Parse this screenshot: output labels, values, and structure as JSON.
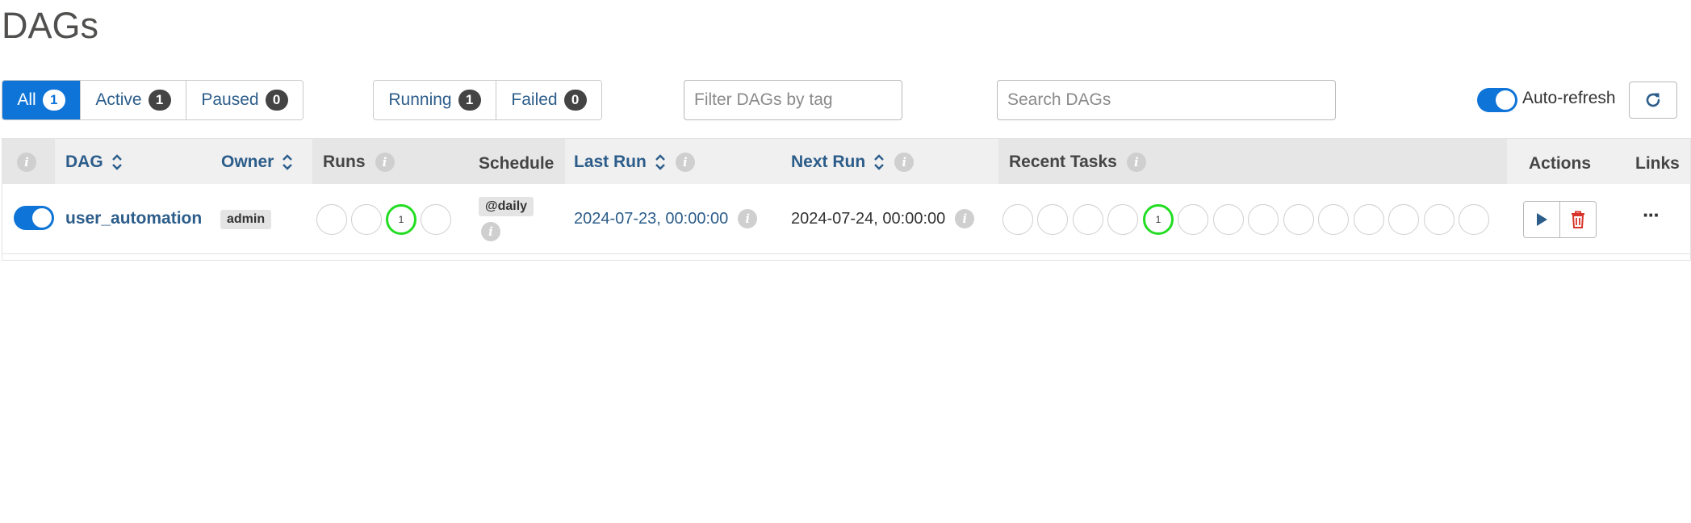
{
  "page_title": "DAGs",
  "status_filters": {
    "all": {
      "label": "All",
      "count": "1"
    },
    "active": {
      "label": "Active",
      "count": "1"
    },
    "paused": {
      "label": "Paused",
      "count": "0"
    }
  },
  "run_filters": {
    "running": {
      "label": "Running",
      "count": "1"
    },
    "failed": {
      "label": "Failed",
      "count": "0"
    }
  },
  "tag_filter": {
    "placeholder": "Filter DAGs by tag"
  },
  "search": {
    "placeholder": "Search DAGs"
  },
  "auto_refresh": {
    "label": "Auto-refresh",
    "enabled": true
  },
  "table": {
    "headers": {
      "dag": "DAG",
      "owner": "Owner",
      "runs": "Runs",
      "schedule": "Schedule",
      "last_run": "Last Run",
      "next_run": "Next Run",
      "recent_tasks": "Recent Tasks",
      "actions": "Actions",
      "links": "Links"
    },
    "rows": [
      {
        "enabled": true,
        "dag_id": "user_automation",
        "owner": "admin",
        "runs": [
          "",
          "",
          "1",
          ""
        ],
        "schedule": "@daily",
        "last_run": "2024-07-23, 00:00:00",
        "next_run": "2024-07-24, 00:00:00",
        "recent_tasks": [
          "",
          "",
          "",
          "",
          "1",
          "",
          "",
          "",
          "",
          "",
          "",
          "",
          "",
          ""
        ],
        "links_label": "···"
      }
    ]
  },
  "colors": {
    "accent": "#0f74d8",
    "link": "#2c5d8a",
    "success": "#22dd22",
    "delete": "#d9342b"
  },
  "icons": {
    "refresh": "refresh-icon",
    "play": "play-icon",
    "delete": "trash-icon",
    "sort": "sort-icon",
    "info": "info-icon"
  }
}
